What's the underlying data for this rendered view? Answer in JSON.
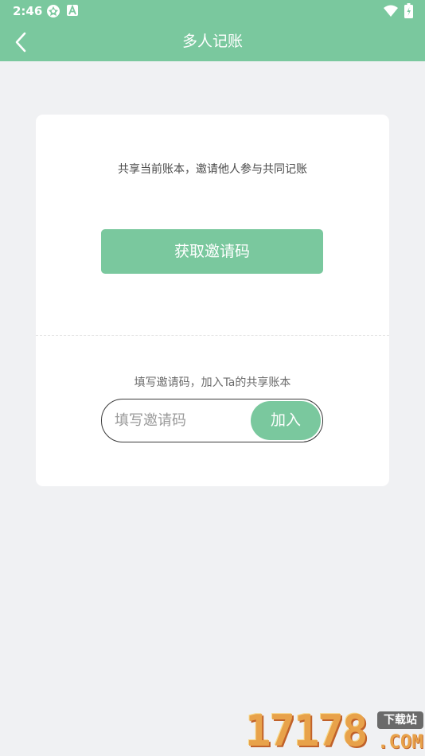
{
  "status_bar": {
    "time": "2:46",
    "icons": [
      "settings-icon",
      "a-notification-icon",
      "wifi-icon",
      "battery-icon"
    ]
  },
  "header": {
    "title": "多人记账",
    "back_icon": "chevron-left-icon"
  },
  "card": {
    "share_description": "共享当前账本，邀请他人参与共同记账",
    "get_code_label": "获取邀请码",
    "join_description": "填写邀请码，加入Ta的共享账本",
    "code_input": {
      "value": "",
      "placeholder": "填写邀请码"
    },
    "join_label": "加入"
  },
  "watermark": {
    "digits": "17178",
    "sub": "下载站",
    "com": ".COM"
  },
  "colors": {
    "accent": "#7ac89e",
    "page_background": "#f0f1f3",
    "card_background": "#ffffff"
  }
}
